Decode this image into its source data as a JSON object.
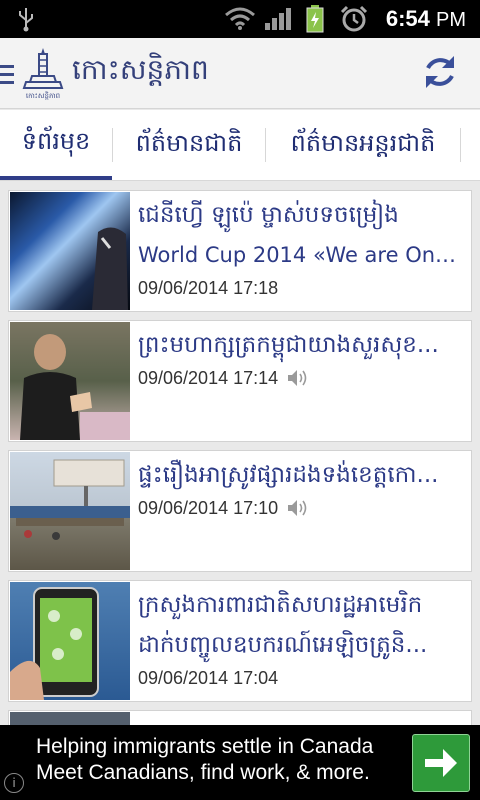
{
  "status_bar": {
    "time": "6:54",
    "ampm": "PM",
    "icons": [
      "usb-icon",
      "wifi-icon",
      "signal-icon",
      "battery-icon",
      "alarm-icon"
    ]
  },
  "header": {
    "title": "កោះសន្តិភាព",
    "logo_label": "កោះសន្តិភាព",
    "icons": [
      "menu-icon",
      "refresh-icon"
    ],
    "accent": "#34407a"
  },
  "tabs": [
    {
      "label": "ទំព័រមុខ",
      "active": true
    },
    {
      "label": "ព័ត៌មានជាតិ",
      "active": false
    },
    {
      "label": "ព័ត៌មានអន្តរជាតិ",
      "active": false
    }
  ],
  "articles": [
    {
      "line1": "ជេនីហ្វើ ឡូប៉េ ម្ចាស់បទចម្រៀង",
      "line2": "World Cup 2014 «We are One...",
      "date": "09/06/2014 17:18",
      "audio": false
    },
    {
      "line1": "ព្រះមហាក្សត្រកម្ពុជាយាងសួរសុខ...",
      "line2": "",
      "date": "09/06/2014 17:14",
      "audio": true
    },
    {
      "line1": "ផ្ទះរឿងអាស្រូវផ្សារដងទង់ខេត្តកោ...",
      "line2": "",
      "date": "09/06/2014 17:10",
      "audio": true
    },
    {
      "line1": "ក្រសួងការពារជាតិសហរដ្ឋអាមេរិក",
      "line2": "ដាក់បញ្ចូលឧបករណ៍អេឡិចត្រូនិ...",
      "date": "09/06/2014 17:04",
      "audio": false
    }
  ],
  "ad": {
    "line1": "Helping immigrants settle in Canada",
    "line2": "Meet Canadians, find work, & more.",
    "info": "i",
    "button_color": "#2e9a3a"
  }
}
